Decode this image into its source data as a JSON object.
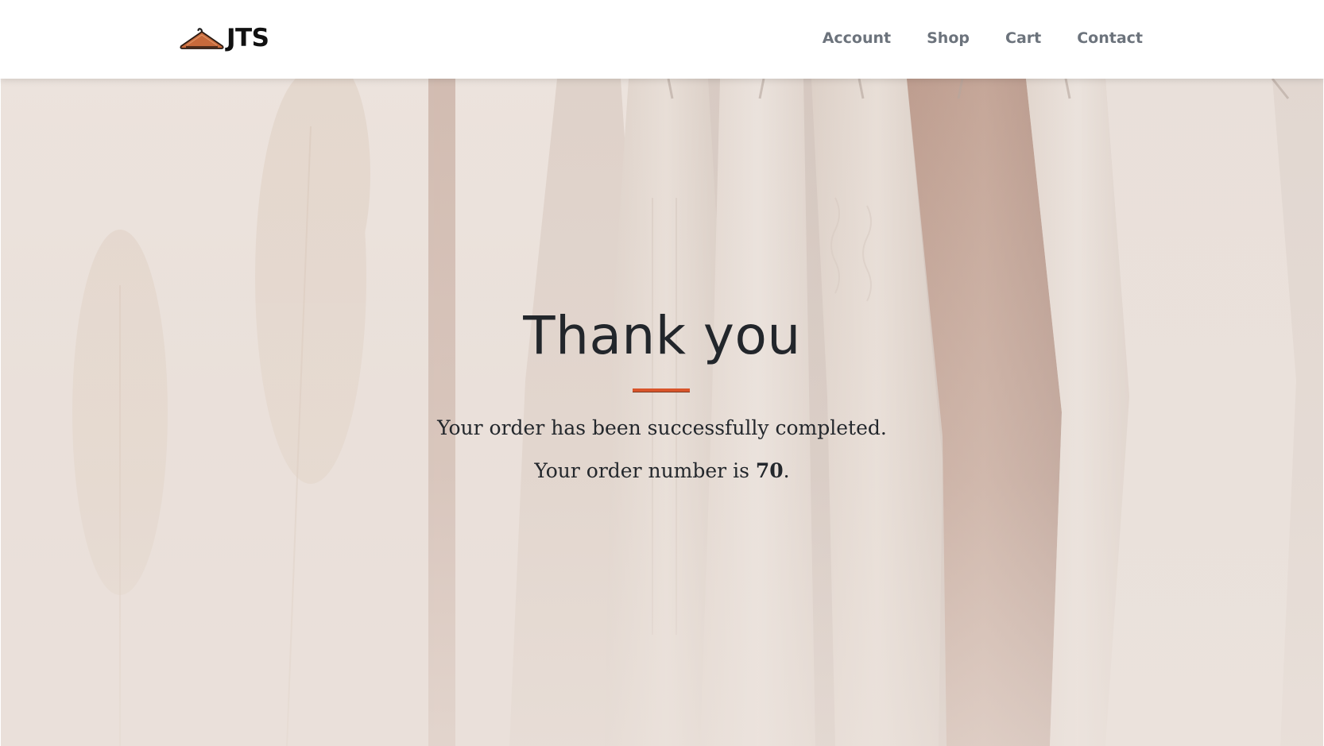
{
  "brand": {
    "name": "JTS",
    "icon": "hanger-icon"
  },
  "nav": {
    "items": [
      {
        "label": "Account"
      },
      {
        "label": "Shop"
      },
      {
        "label": "Cart"
      },
      {
        "label": "Contact"
      }
    ]
  },
  "hero": {
    "background": "clothes-rack-photo",
    "title": "Thank you",
    "message": "Your order has been successfully completed.",
    "order_prefix": "Your order number is ",
    "order_number": "70",
    "order_suffix": "."
  },
  "colors": {
    "accent": "#d9552b",
    "nav_text": "#6c737c",
    "title_text": "#22262b",
    "hero_bg": "#e9dfd8"
  }
}
